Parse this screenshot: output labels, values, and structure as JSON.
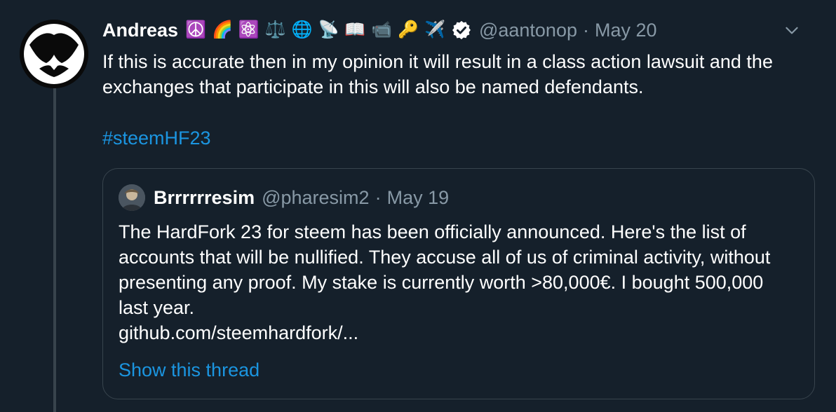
{
  "tweet": {
    "author_name": "Andreas",
    "name_emojis": [
      "☮️",
      "🌈",
      "⚛️",
      "⚖️",
      "🌐",
      "📡",
      "📖",
      "📹",
      "🔑",
      "✈️"
    ],
    "handle": "@aantonop",
    "separator": "·",
    "date": "May 20",
    "text": "If this is accurate then in my opinion it will result in a class action lawsuit and the exchanges that participate in this will also be named defendants.",
    "hashtag": "#steemHF23"
  },
  "quote": {
    "author_name": "Brrrrrresim",
    "handle": "@pharesim2",
    "separator": "·",
    "date": "May 19",
    "text": "The HardFork 23 for steem has been officially announced. Here's the list of accounts that will be nullified. They accuse all of us of criminal activity, without presenting any proof. My stake is currently worth >80,000€. I bought 500,000 last year.",
    "link": "github.com/steemhardfork/...",
    "show_thread": "Show this thread"
  },
  "colors": {
    "background": "#15202b",
    "text": "#ffffff",
    "secondary_text": "#8899a6",
    "link": "#1b95e0",
    "border": "#38444d"
  },
  "icons": {
    "verified": "verified-badge-icon",
    "caret": "chevron-down-icon"
  }
}
